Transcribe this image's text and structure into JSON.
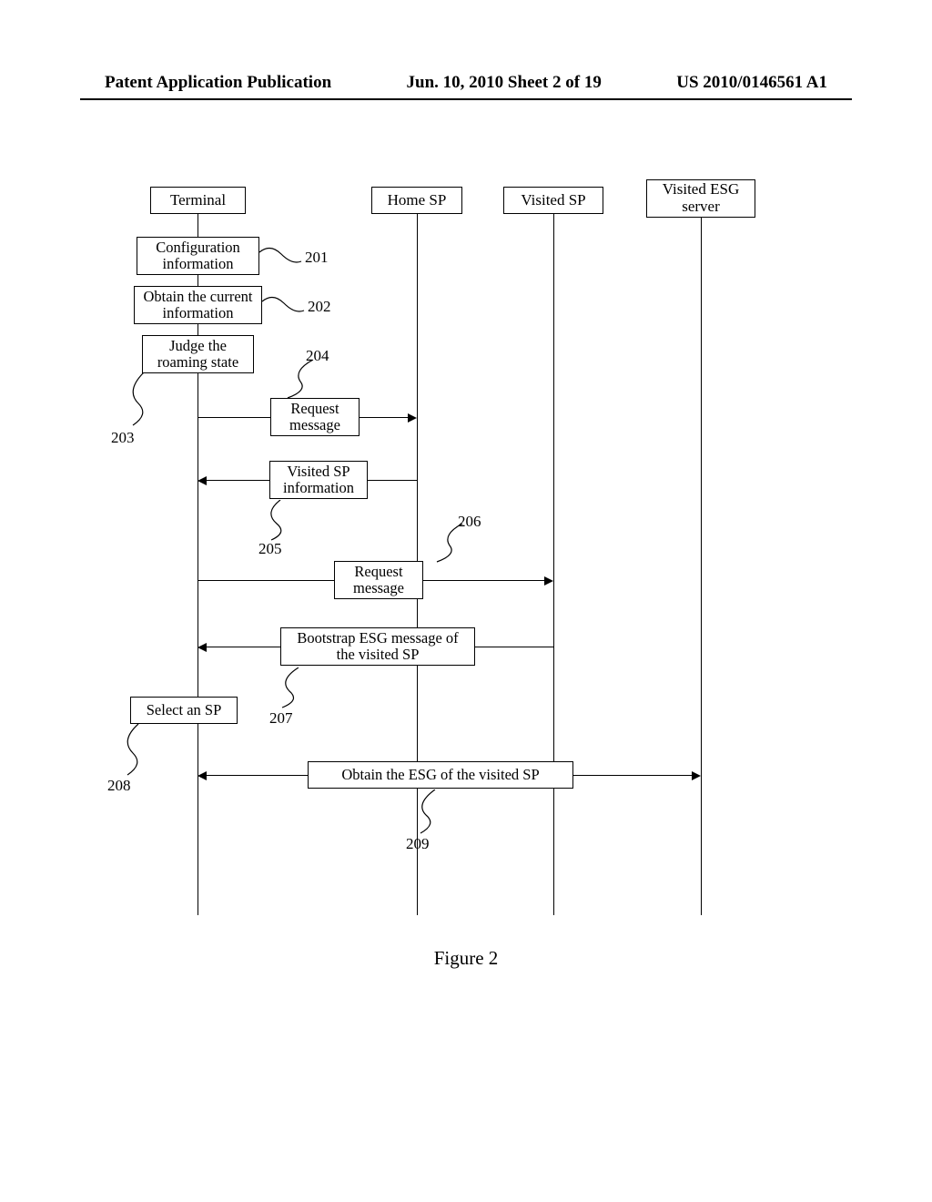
{
  "header": {
    "left": "Patent Application Publication",
    "center": "Jun. 10, 2010  Sheet 2 of 19",
    "right": "US 2010/0146561 A1"
  },
  "lanes": {
    "terminal": "Terminal",
    "home_sp": "Home SP",
    "visited_sp": "Visited SP",
    "visited_esg_line1": "Visited ESG",
    "visited_esg_line2": "server"
  },
  "steps": {
    "s201a": "Configuration",
    "s201b": "information",
    "s202a": "Obtain the current",
    "s202b": "information",
    "s203a": "Judge the",
    "s203b": "roaming state",
    "s208": "Select an SP"
  },
  "messages": {
    "m204a": "Request",
    "m204b": "message",
    "m205a": "Visited SP",
    "m205b": "information",
    "m206a": "Request",
    "m206b": "message",
    "m207a": "Bootstrap ESG message of",
    "m207b": "the visited SP",
    "m209": "Obtain the ESG of the visited SP"
  },
  "callouts": {
    "n201": "201",
    "n202": "202",
    "n203": "203",
    "n204": "204",
    "n205": "205",
    "n206": "206",
    "n207": "207",
    "n208": "208",
    "n209": "209"
  },
  "figure_caption": "Figure 2"
}
